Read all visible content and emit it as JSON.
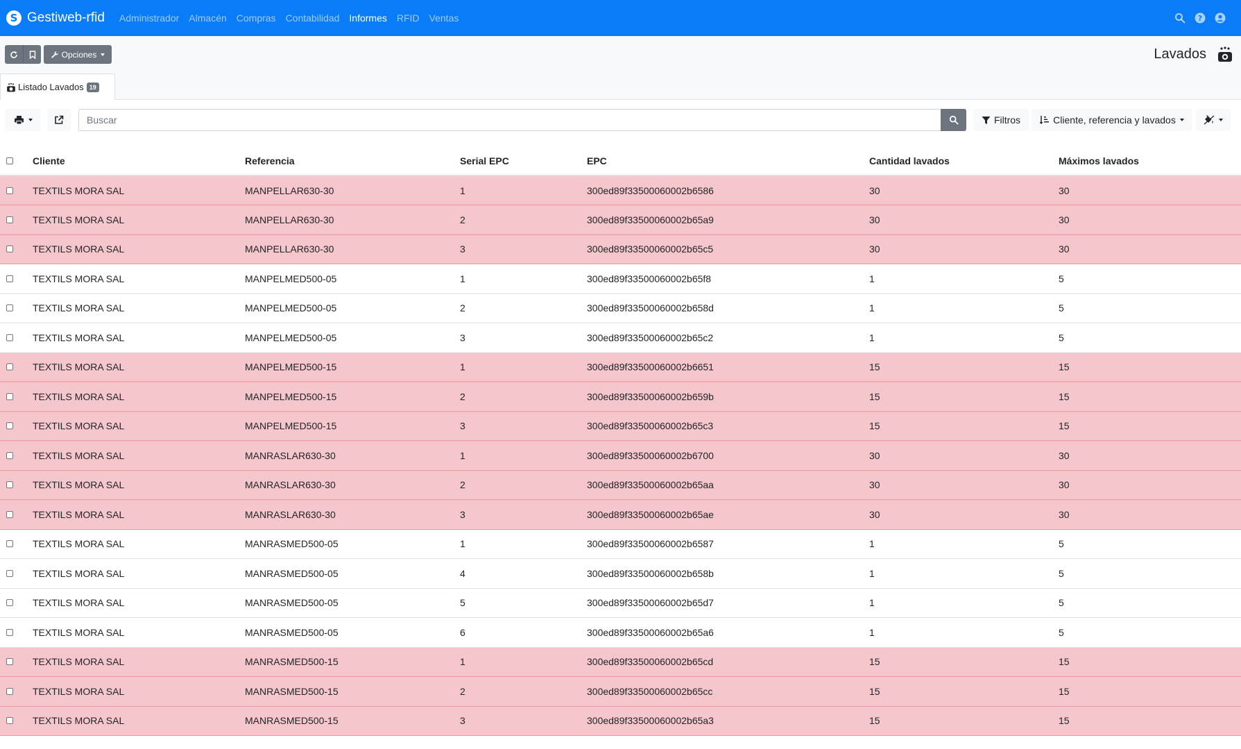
{
  "app": {
    "name": "Gestiweb-rfid"
  },
  "nav": {
    "items": [
      {
        "label": "Administrador",
        "active": false
      },
      {
        "label": "Almacén",
        "active": false
      },
      {
        "label": "Compras",
        "active": false
      },
      {
        "label": "Contabilidad",
        "active": false
      },
      {
        "label": "Informes",
        "active": true
      },
      {
        "label": "RFID",
        "active": false
      },
      {
        "label": "Ventas",
        "active": false
      }
    ],
    "icons": [
      "search-icon",
      "help-icon",
      "user-icon"
    ]
  },
  "toolbar": {
    "options_label": "Opciones"
  },
  "page": {
    "title": "Lavados"
  },
  "tab": {
    "label": "Listado Lavados",
    "count": "19"
  },
  "search": {
    "placeholder": "Buscar"
  },
  "actions": {
    "filters_label": "Filtros",
    "sort_label": "Cliente, referencia y lavados"
  },
  "colors": {
    "primary": "#0a7cf8",
    "secondary": "#6c757d",
    "danger_row": "#f5c6cb"
  },
  "table": {
    "columns": [
      "Cliente",
      "Referencia",
      "Serial EPC",
      "EPC",
      "Cantidad lavados",
      "Máximos lavados"
    ],
    "rows": [
      {
        "cliente": "TEXTILS MORA SAL",
        "referencia": "MANPELLAR630-30",
        "serial": "1",
        "epc": "300ed89f33500060002b6586",
        "cantidad": "30",
        "maximos": "30",
        "highlight": true
      },
      {
        "cliente": "TEXTILS MORA SAL",
        "referencia": "MANPELLAR630-30",
        "serial": "2",
        "epc": "300ed89f33500060002b65a9",
        "cantidad": "30",
        "maximos": "30",
        "highlight": true
      },
      {
        "cliente": "TEXTILS MORA SAL",
        "referencia": "MANPELLAR630-30",
        "serial": "3",
        "epc": "300ed89f33500060002b65c5",
        "cantidad": "30",
        "maximos": "30",
        "highlight": true
      },
      {
        "cliente": "TEXTILS MORA SAL",
        "referencia": "MANPELMED500-05",
        "serial": "1",
        "epc": "300ed89f33500060002b65f8",
        "cantidad": "1",
        "maximos": "5",
        "highlight": false
      },
      {
        "cliente": "TEXTILS MORA SAL",
        "referencia": "MANPELMED500-05",
        "serial": "2",
        "epc": "300ed89f33500060002b658d",
        "cantidad": "1",
        "maximos": "5",
        "highlight": false
      },
      {
        "cliente": "TEXTILS MORA SAL",
        "referencia": "MANPELMED500-05",
        "serial": "3",
        "epc": "300ed89f33500060002b65c2",
        "cantidad": "1",
        "maximos": "5",
        "highlight": false
      },
      {
        "cliente": "TEXTILS MORA SAL",
        "referencia": "MANPELMED500-15",
        "serial": "1",
        "epc": "300ed89f33500060002b6651",
        "cantidad": "15",
        "maximos": "15",
        "highlight": true
      },
      {
        "cliente": "TEXTILS MORA SAL",
        "referencia": "MANPELMED500-15",
        "serial": "2",
        "epc": "300ed89f33500060002b659b",
        "cantidad": "15",
        "maximos": "15",
        "highlight": true
      },
      {
        "cliente": "TEXTILS MORA SAL",
        "referencia": "MANPELMED500-15",
        "serial": "3",
        "epc": "300ed89f33500060002b65c3",
        "cantidad": "15",
        "maximos": "15",
        "highlight": true
      },
      {
        "cliente": "TEXTILS MORA SAL",
        "referencia": "MANRASLAR630-30",
        "serial": "1",
        "epc": "300ed89f33500060002b6700",
        "cantidad": "30",
        "maximos": "30",
        "highlight": true
      },
      {
        "cliente": "TEXTILS MORA SAL",
        "referencia": "MANRASLAR630-30",
        "serial": "2",
        "epc": "300ed89f33500060002b65aa",
        "cantidad": "30",
        "maximos": "30",
        "highlight": true
      },
      {
        "cliente": "TEXTILS MORA SAL",
        "referencia": "MANRASLAR630-30",
        "serial": "3",
        "epc": "300ed89f33500060002b65ae",
        "cantidad": "30",
        "maximos": "30",
        "highlight": true
      },
      {
        "cliente": "TEXTILS MORA SAL",
        "referencia": "MANRASMED500-05",
        "serial": "1",
        "epc": "300ed89f33500060002b6587",
        "cantidad": "1",
        "maximos": "5",
        "highlight": false
      },
      {
        "cliente": "TEXTILS MORA SAL",
        "referencia": "MANRASMED500-05",
        "serial": "4",
        "epc": "300ed89f33500060002b658b",
        "cantidad": "1",
        "maximos": "5",
        "highlight": false
      },
      {
        "cliente": "TEXTILS MORA SAL",
        "referencia": "MANRASMED500-05",
        "serial": "5",
        "epc": "300ed89f33500060002b65d7",
        "cantidad": "1",
        "maximos": "5",
        "highlight": false
      },
      {
        "cliente": "TEXTILS MORA SAL",
        "referencia": "MANRASMED500-05",
        "serial": "6",
        "epc": "300ed89f33500060002b65a6",
        "cantidad": "1",
        "maximos": "5",
        "highlight": false
      },
      {
        "cliente": "TEXTILS MORA SAL",
        "referencia": "MANRASMED500-15",
        "serial": "1",
        "epc": "300ed89f33500060002b65cd",
        "cantidad": "15",
        "maximos": "15",
        "highlight": true
      },
      {
        "cliente": "TEXTILS MORA SAL",
        "referencia": "MANRASMED500-15",
        "serial": "2",
        "epc": "300ed89f33500060002b65cc",
        "cantidad": "15",
        "maximos": "15",
        "highlight": true
      },
      {
        "cliente": "TEXTILS MORA SAL",
        "referencia": "MANRASMED500-15",
        "serial": "3",
        "epc": "300ed89f33500060002b65a3",
        "cantidad": "15",
        "maximos": "15",
        "highlight": true
      }
    ]
  }
}
